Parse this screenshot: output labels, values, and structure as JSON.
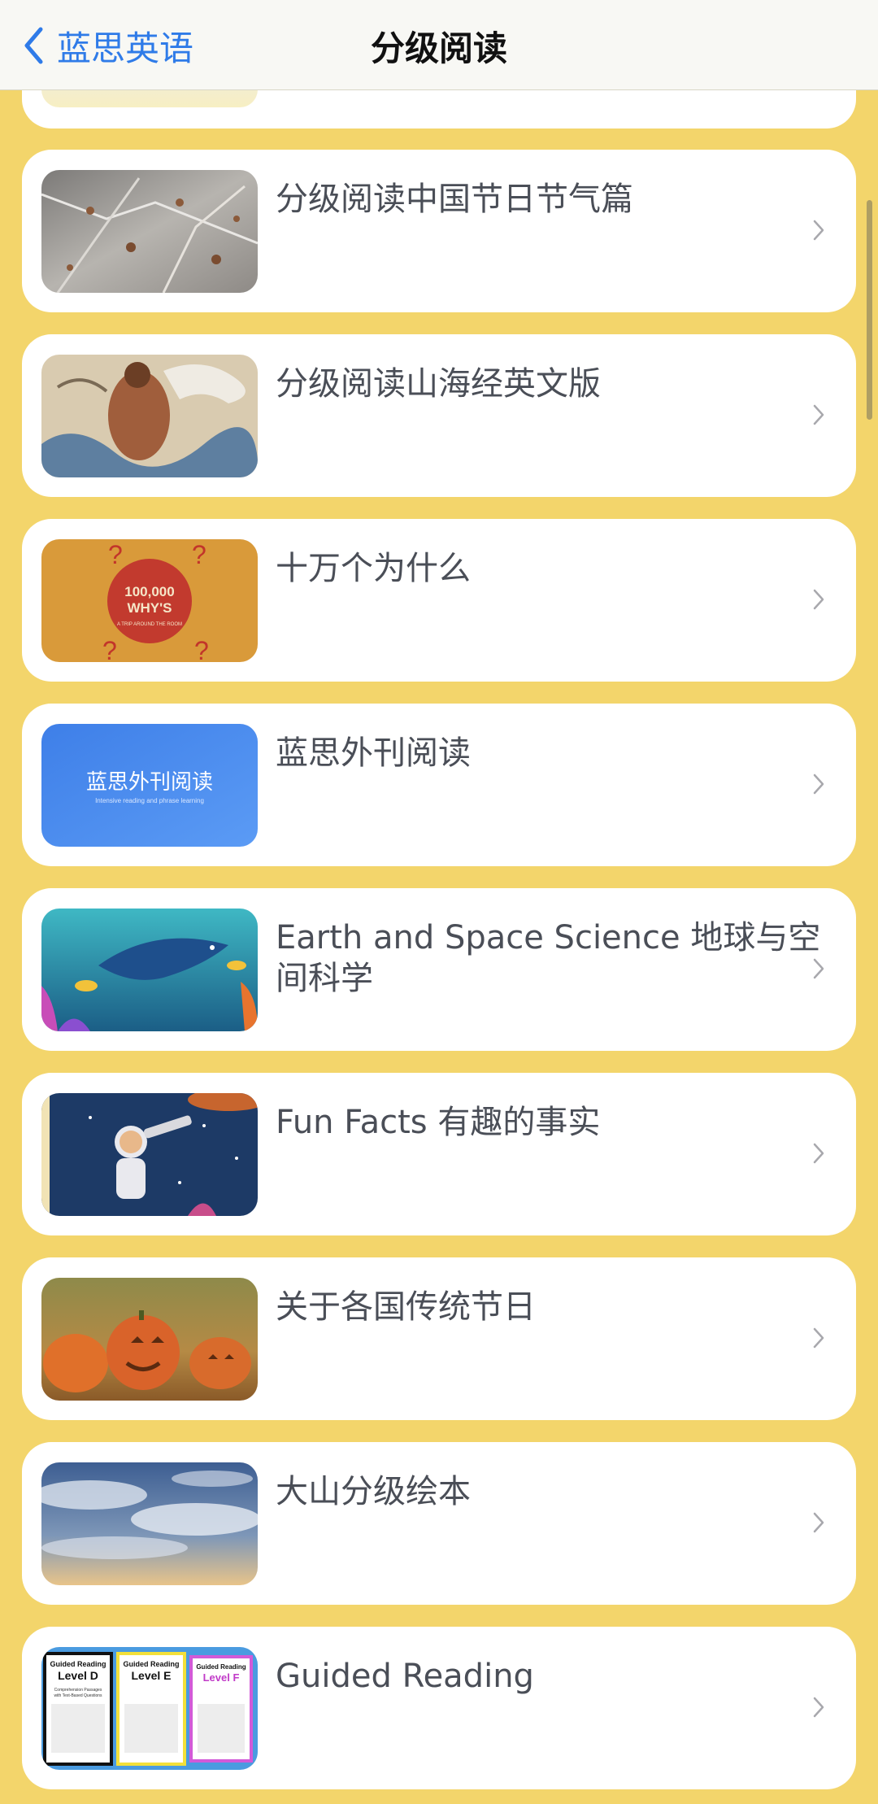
{
  "nav": {
    "back_label": "蓝思英语",
    "title": "分级阅读"
  },
  "items": [
    {
      "title": "分级阅读中国节日节气篇"
    },
    {
      "title": "分级阅读山海经英文版"
    },
    {
      "title": "十万个为什么",
      "thumb_text": [
        "100,000",
        "WHY'S",
        "A TRIP AROUND THE ROOM"
      ]
    },
    {
      "title": "蓝思外刊阅读",
      "thumb_text": [
        "蓝思外刊阅读",
        "Intensive reading and phrase learning"
      ]
    },
    {
      "title": "Earth and Space Science 地球与空间科学"
    },
    {
      "title": "Fun Facts 有趣的事实"
    },
    {
      "title": "关于各国传统节日"
    },
    {
      "title": "大山分级绘本"
    },
    {
      "title": "Guided Reading",
      "thumb_text": [
        "Guided Reading",
        "Level D",
        "Guided Reading",
        "Level E",
        "Guided Reading",
        "Level F",
        "Comprehension Passages",
        "with Text-Based Questions"
      ]
    }
  ],
  "colors": {
    "background": "#F3D56B",
    "accent": "#2F7BE8",
    "card": "#FFFFFF"
  }
}
